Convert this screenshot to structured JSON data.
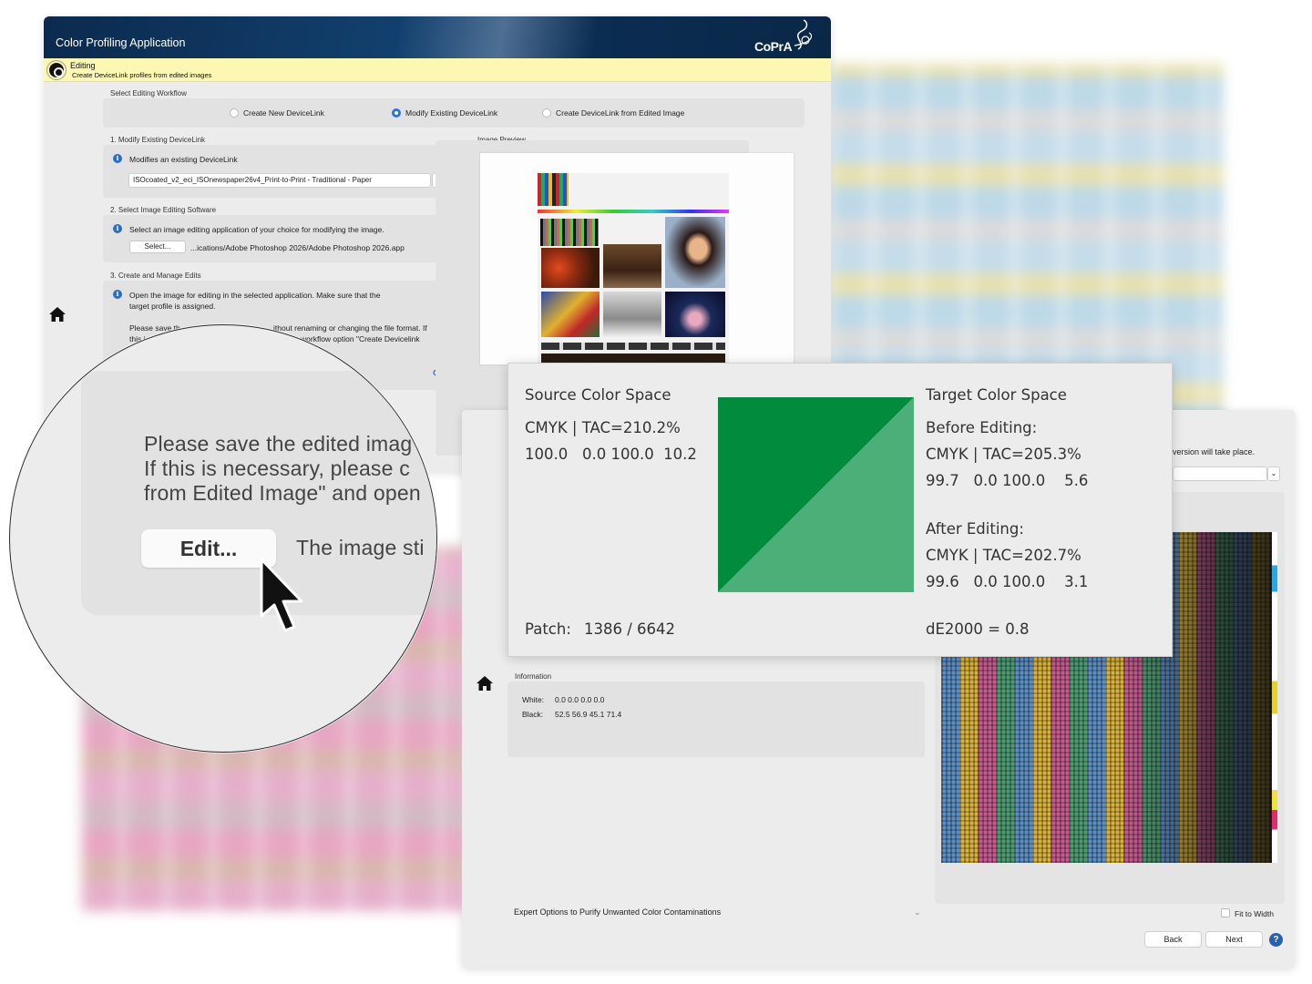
{
  "main_window": {
    "title": "Color Profiling Application",
    "brand": "CoPrA",
    "mode_title": "Editing",
    "mode_subtitle": "Create DeviceLink profiles from edited images",
    "workflow_label": "Select Editing Workflow",
    "workflow_options": [
      {
        "label": "Create New DeviceLink",
        "selected": false
      },
      {
        "label": "Modify Existing DeviceLink",
        "selected": true
      },
      {
        "label": "Create DeviceLink from Edited Image",
        "selected": false
      }
    ],
    "section1": {
      "title": "1. Modify Existing DeviceLink",
      "info": "Modifies an existing DeviceLink",
      "devicelink_value": "ISOcoated_v2_eci_ISOnewspaper26v4_Print-to-Print - Traditional - Paper"
    },
    "section2": {
      "title": "2. Select Image Editing Software",
      "info": "Select an image editing application of your choice for modifying the image.",
      "select_button": "Select...",
      "app_path": "...ications/Adobe Photoshop 2026/Adobe Photoshop 2026.app"
    },
    "section3": {
      "title": "3. Create and Manage Edits",
      "info_line1": "Open the image for editing in the selected application. Make sure that the",
      "info_line2": "target profile is assigned.",
      "partial_line1": "Please save th",
      "partial_line1b": "ithout renaming or changing the file format. If",
      "partial_line2": "this i",
      "partial_line2b": "workflow option \"Create Devicelink"
    },
    "preview_label": "Image Preview"
  },
  "magnifier": {
    "line1": "Please save the edited imag",
    "line2": "If this is necessary, please c",
    "line3": "from Edited Image\" and open",
    "edit_button": "Edit...",
    "side_text": "The image sti"
  },
  "patch_popup": {
    "source_title": "Source Color Space",
    "source_space": "CMYK | TAC=210.2%",
    "source_values": "100.0   0.0 100.0  10.2",
    "target_title": "Target Color Space",
    "before_label": "Before Editing:",
    "before_space": "CMYK | TAC=205.3%",
    "before_values": "99.7   0.0 100.0    5.6",
    "after_label": "After Editing:",
    "after_space": "CMYK | TAC=202.7%",
    "after_values": "99.6   0.0 100.0    3.1",
    "patch_label": "Patch:",
    "patch_value": "1386 / 6642",
    "delta_e": "dE2000 = 0.8",
    "swatch_before_color": "#008c3c",
    "swatch_after_color": "#4caf78"
  },
  "second_window": {
    "note_partial": "version will take place.",
    "info_label": "Information",
    "white_label": "White:",
    "white_values": "0.0 0.0 0.0 0.0",
    "black_label": "Black:",
    "black_values": "52.5 56.9 45.1 71.4",
    "expert_label": "Expert Options to Purify Unwanted Color Contaminations",
    "fit_to_width": "Fit to Width",
    "back_button": "Back",
    "next_button": "Next",
    "help": "?"
  },
  "icons": {
    "home": "home-icon",
    "info": "i",
    "chevron": "⌄",
    "eye": "eye-icon"
  }
}
